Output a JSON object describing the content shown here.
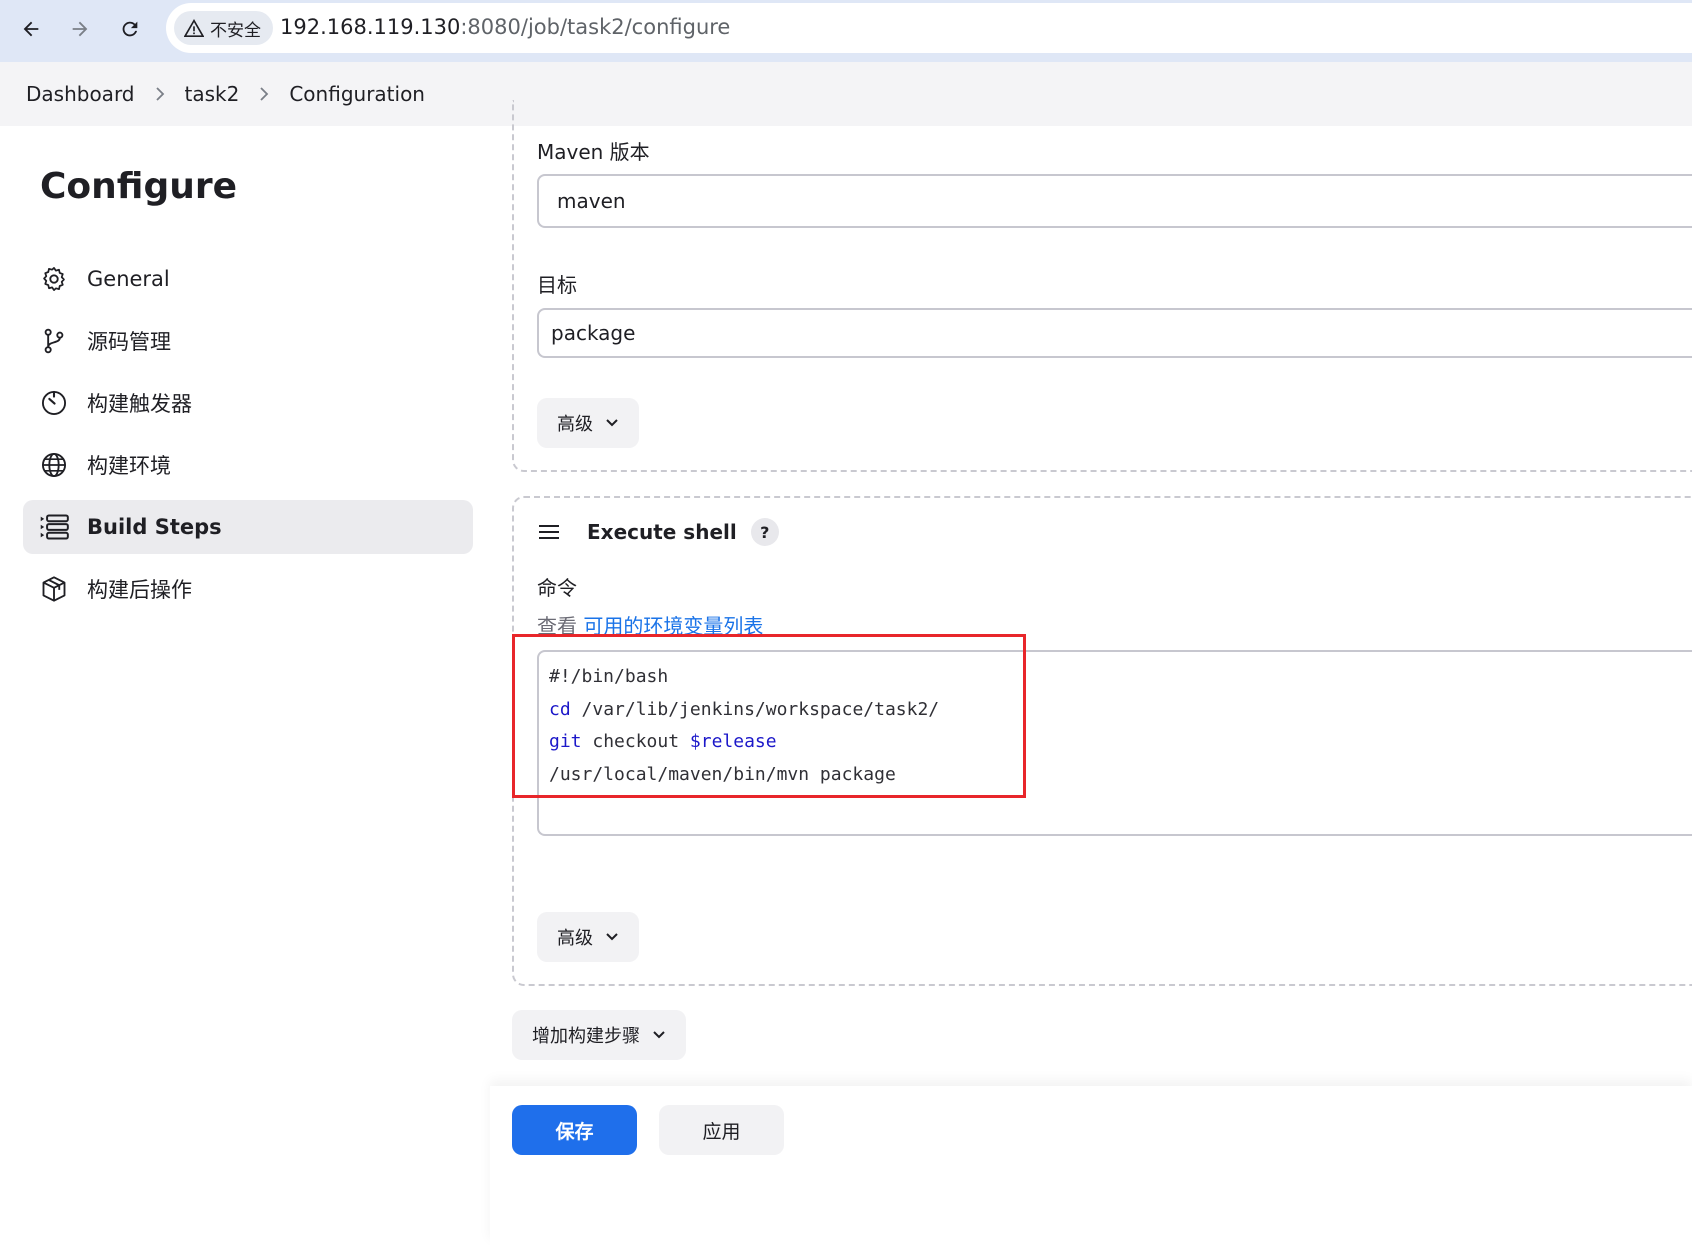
{
  "browser": {
    "security_label": "不安全",
    "url_host": "192.168.119.130",
    "url_path": ":8080/job/task2/configure"
  },
  "breadcrumb": {
    "items": [
      "Dashboard",
      "task2",
      "Configuration"
    ]
  },
  "sidebar": {
    "title": "Configure",
    "items": [
      {
        "label": "General",
        "icon": "gear-icon"
      },
      {
        "label": "源码管理",
        "icon": "branch-icon"
      },
      {
        "label": "构建触发器",
        "icon": "timer-icon"
      },
      {
        "label": "构建环境",
        "icon": "globe-icon"
      },
      {
        "label": "Build Steps",
        "icon": "list-icon",
        "active": true
      },
      {
        "label": "构建后操作",
        "icon": "package-icon"
      }
    ]
  },
  "maven_step": {
    "version_label": "Maven 版本",
    "version_value": "maven",
    "goals_label": "目标",
    "goals_value": "package",
    "advanced_label": "高级"
  },
  "shell_step": {
    "title": "Execute shell",
    "help": "?",
    "command_label": "命令",
    "env_prefix": "查看 ",
    "env_link": "可用的环境变量列表",
    "code": {
      "line1": "#!/bin/bash",
      "line2_kw": "cd",
      "line2_rest": " /var/lib/jenkins/workspace/task2/",
      "line3_kw": "git",
      "line3_mid": " checkout ",
      "line3_var": "$release",
      "line4": "/usr/local/maven/bin/mvn package"
    },
    "advanced_label": "高级"
  },
  "add_step_label": "增加构建步骤",
  "actions": {
    "save": "保存",
    "apply": "应用"
  },
  "colors": {
    "primary": "#1f6feb",
    "highlight": "#e8262a",
    "link": "#1a73e8"
  }
}
